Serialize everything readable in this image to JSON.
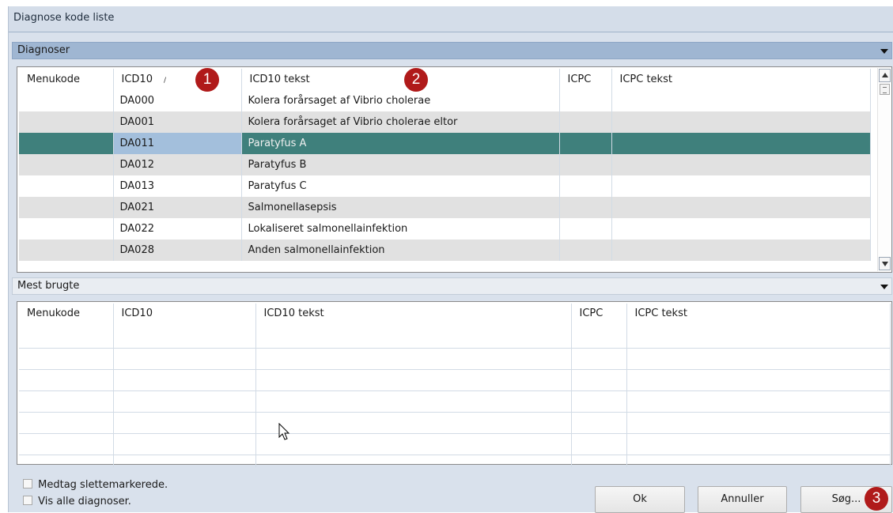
{
  "window": {
    "title": "Diagnose kode liste"
  },
  "diagnoser": {
    "header": "Diagnoser",
    "columns": [
      "Menukode",
      "ICD10",
      "ICD10 tekst",
      "ICPC",
      "ICPC tekst"
    ],
    "sort_indicator": "/",
    "rows": [
      {
        "menukode": "",
        "icd10": "DA000",
        "icd10_tekst": "Kolera forårsaget af Vibrio cholerae",
        "icpc": "",
        "icpc_tekst": ""
      },
      {
        "menukode": "",
        "icd10": "DA001",
        "icd10_tekst": "Kolera forårsaget af Vibrio cholerae eltor",
        "icpc": "",
        "icpc_tekst": ""
      },
      {
        "menukode": "",
        "icd10": "DA011",
        "icd10_tekst": "Paratyfus A",
        "icpc": "",
        "icpc_tekst": ""
      },
      {
        "menukode": "",
        "icd10": "DA012",
        "icd10_tekst": "Paratyfus B",
        "icpc": "",
        "icpc_tekst": ""
      },
      {
        "menukode": "",
        "icd10": "DA013",
        "icd10_tekst": "Paratyfus C",
        "icpc": "",
        "icpc_tekst": ""
      },
      {
        "menukode": "",
        "icd10": "DA021",
        "icd10_tekst": "Salmonellasepsis",
        "icpc": "",
        "icpc_tekst": ""
      },
      {
        "menukode": "",
        "icd10": "DA022",
        "icd10_tekst": "Lokaliseret salmonellainfektion",
        "icpc": "",
        "icpc_tekst": ""
      },
      {
        "menukode": "",
        "icd10": "DA028",
        "icd10_tekst": "Anden salmonellainfektion",
        "icpc": "",
        "icpc_tekst": ""
      }
    ],
    "selected_row": "DA011"
  },
  "mest_brugte": {
    "header": "Mest brugte",
    "columns": [
      "Menukode",
      "ICD10",
      "ICD10 tekst",
      "ICPC",
      "ICPC tekst"
    ]
  },
  "options": {
    "include_deleted": "Medtag slettemarkerede.",
    "show_all": "Vis alle diagnoser."
  },
  "buttons": {
    "ok": "Ok",
    "cancel": "Annuller",
    "search": "Søg..."
  },
  "callouts": {
    "one": "1",
    "two": "2",
    "three": "3"
  }
}
